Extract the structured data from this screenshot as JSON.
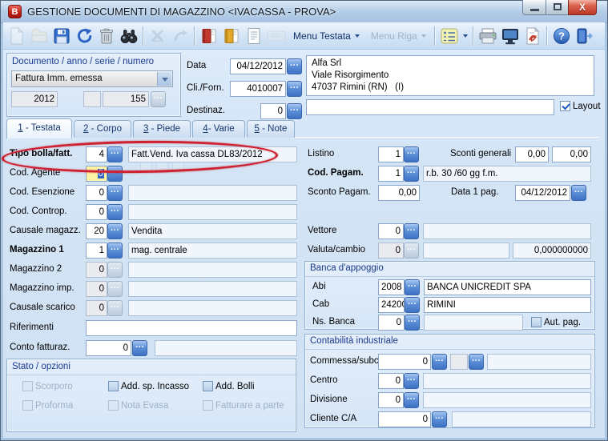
{
  "window": {
    "title": "GESTIONE DOCUMENTI DI MAGAZZINO <IVACASSA - PROVA>",
    "icon_letter": "B"
  },
  "toolbar": {
    "menu_testata": "Menu Testata",
    "menu_riga": "Menu Riga",
    "icons": [
      "new-document",
      "open-folder",
      "save",
      "undo",
      "delete",
      "find",
      "annul-document",
      "restore-document",
      "red-book",
      "yellow-book",
      "document-preview",
      "panel",
      "list-settings",
      "print",
      "screen-preview",
      "pdf-export",
      "help",
      "exit"
    ]
  },
  "doc_panel": {
    "header": "Documento / anno / serie / numero",
    "tipo_documento": "Fattura Imm. emessa",
    "anno": "2012",
    "serie": "",
    "numero": "155"
  },
  "top": {
    "data_label": "Data",
    "data_value": "04/12/2012",
    "cliforn_label": "Cli./Forn.",
    "cliforn_value": "4010007",
    "destinaz_label": "Destinaz.",
    "destinaz_value": "0",
    "destinaz_desc": "",
    "address_line1": "Alfa Srl",
    "address_line2": "Viale Risorgimento",
    "address_line3": "47037 Rimini (RN)   (I)",
    "layout_label": "Layout",
    "layout_checked": true
  },
  "tabs": [
    {
      "num": "1",
      "suffix": " - Testata",
      "active": true
    },
    {
      "num": "2",
      "suffix": " - Corpo",
      "active": false
    },
    {
      "num": "3",
      "suffix": " - Piede",
      "active": false
    },
    {
      "num": "4",
      "suffix": "- Varie",
      "active": false
    },
    {
      "num": "5",
      "suffix": " - Note",
      "active": false
    }
  ],
  "left": {
    "tipo_bolla": {
      "label": "Tipo bolla/fatt.",
      "value": "4",
      "desc": "Fatt.Vend. Iva cassa DL83/2012"
    },
    "cod_agente": {
      "label": "Cod. Agente",
      "value": "0"
    },
    "cod_esenzione": {
      "label": "Cod. Esenzione",
      "value": "0",
      "desc": ""
    },
    "cod_controp": {
      "label": "Cod. Controp.",
      "value": "0",
      "desc": ""
    },
    "causale_magazz": {
      "label": "Causale magazz.",
      "value": "20",
      "desc": "Vendita"
    },
    "magazzino1": {
      "label": "Magazzino 1",
      "value": "1",
      "desc": "mag. centrale"
    },
    "magazzino2": {
      "label": "Magazzino 2",
      "value": "0",
      "desc": ""
    },
    "magazzino_imp": {
      "label": "Magazzino imp.",
      "value": "0",
      "desc": ""
    },
    "causale_scarico": {
      "label": "Causale scarico",
      "value": "0",
      "desc": ""
    },
    "riferimenti": {
      "label": "Riferimenti",
      "value": ""
    },
    "conto_fatturaz": {
      "label": "Conto fatturaz.",
      "value": "0",
      "desc": ""
    }
  },
  "right": {
    "listino": {
      "label": "Listino",
      "value": "1"
    },
    "sconti_generali": {
      "label": "Sconti generali",
      "value1": "0,00",
      "value2": "0,00"
    },
    "cod_pagam": {
      "label": "Cod. Pagam.",
      "value": "1",
      "desc": "r.b. 30 /60 gg f.m."
    },
    "sconto_pagam": {
      "label": "Sconto Pagam.",
      "value": "0,00"
    },
    "data_1_pag": {
      "label": "Data 1 pag.",
      "value": "04/12/2012"
    },
    "vettore": {
      "label": "Vettore",
      "value": "0",
      "desc": ""
    },
    "valuta_cambio": {
      "label": "Valuta/cambio",
      "value": "0",
      "desc": "",
      "cambio": "0,000000000"
    }
  },
  "banca": {
    "header": "Banca d'appoggio",
    "abi": {
      "label": "Abi",
      "value": "2008",
      "desc": "BANCA UNICREDIT SPA"
    },
    "cab": {
      "label": "Cab",
      "value": "24200",
      "desc": "RIMINI"
    },
    "ns_banca": {
      "label": "Ns. Banca",
      "value": "0",
      "desc": ""
    },
    "aut_pag_label": "Aut. pag.",
    "aut_pag_checked": false
  },
  "contabilita": {
    "header": "Contabilità industriale",
    "commessa": {
      "label": "Commessa/subc.",
      "value": "0",
      "value2": "",
      "desc": ""
    },
    "centro": {
      "label": "Centro",
      "value": "0",
      "desc": ""
    },
    "divisione": {
      "label": "Divisione",
      "value": "0",
      "desc": ""
    },
    "cliente_ca": {
      "label": "Cliente C/A",
      "value": "0",
      "desc": ""
    }
  },
  "stato": {
    "header": "Stato / opzioni",
    "options": [
      {
        "label": "Scorporo",
        "enabled": false,
        "checked": false
      },
      {
        "label": "Add. sp. Incasso",
        "enabled": true,
        "checked": false
      },
      {
        "label": "Add. Bolli",
        "enabled": true,
        "checked": false
      },
      {
        "label": "Proforma",
        "enabled": false,
        "checked": false
      },
      {
        "label": "Nota Evasa",
        "enabled": false,
        "checked": false
      },
      {
        "label": "Fatturare a parte",
        "enabled": false,
        "checked": false
      }
    ]
  },
  "colors": {
    "accent_blue": "#2b62c4",
    "section_header_text": "#1a3a8c",
    "annotation_red": "#ce2130",
    "focus_field_yellow": "#fdf3a6",
    "titlebar_close_red": "#bd3826"
  }
}
